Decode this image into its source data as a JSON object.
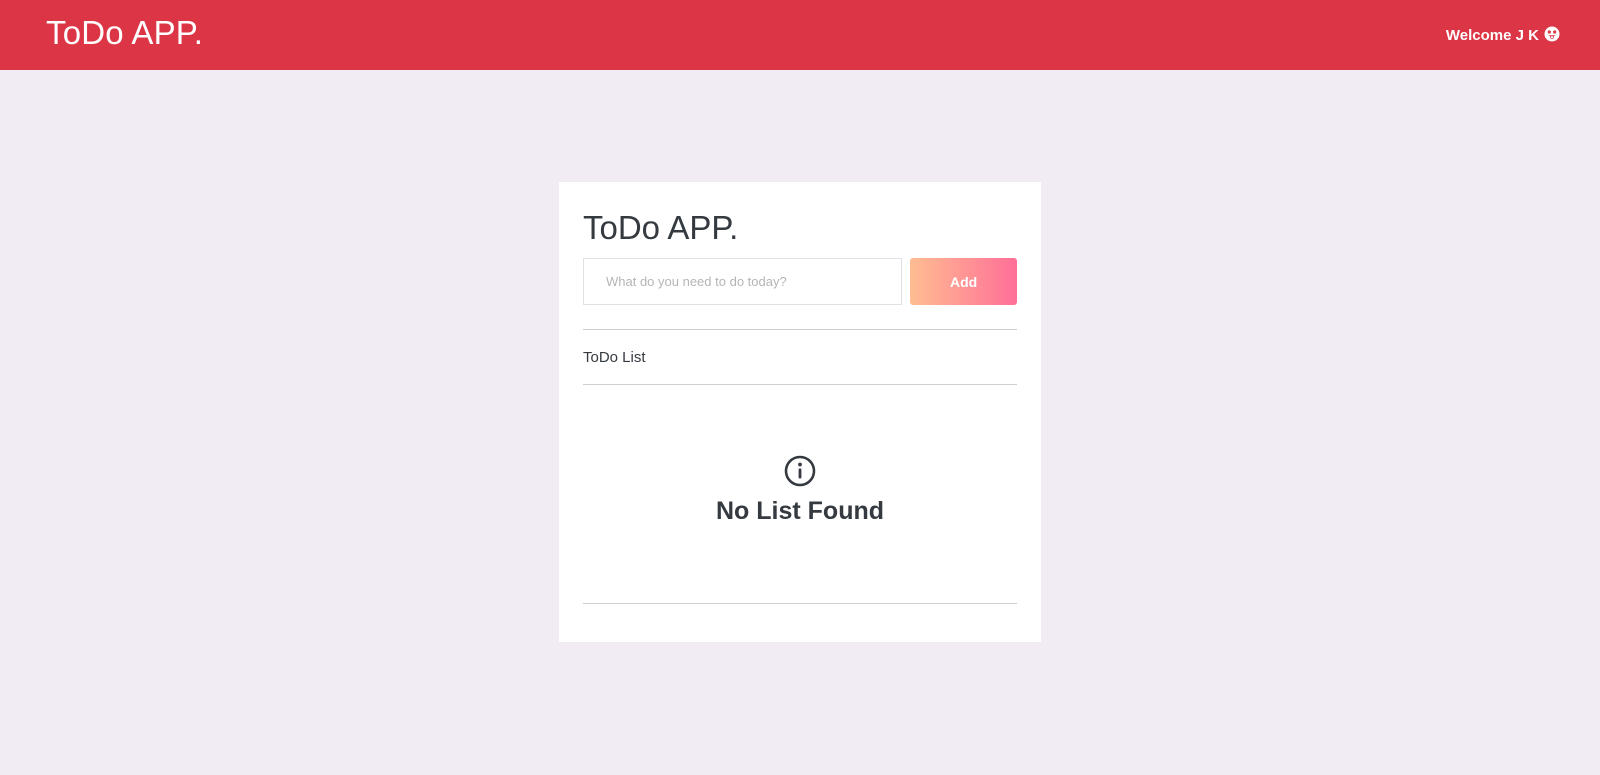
{
  "navbar": {
    "brand": "ToDo APP.",
    "welcome_text": "Welcome J K",
    "welcome_icon": "grin-tongue-icon"
  },
  "card": {
    "title": "ToDo APP.",
    "input": {
      "placeholder": "What do you need to do today?",
      "value": ""
    },
    "add_label": "Add",
    "list_heading": "ToDo List",
    "empty_icon": "info-circle-icon",
    "empty_message": "No List Found"
  },
  "colors": {
    "navbar_bg": "#dc3545",
    "page_bg": "#f1ecf3",
    "button_gradient_start": "#ffbd91",
    "button_gradient_end": "#ff6f98",
    "text_dark": "#343a40"
  }
}
